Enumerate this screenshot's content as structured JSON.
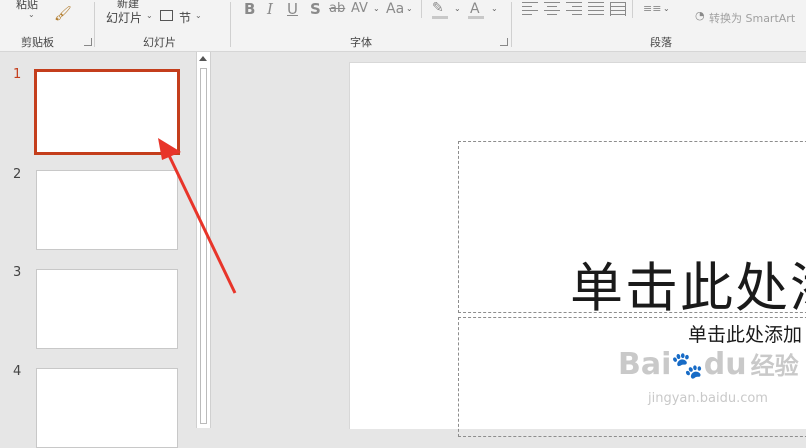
{
  "ribbon": {
    "paste_label": "粘贴",
    "new_slide_top": "新建",
    "new_slide_bottom": "幻灯片",
    "section_label": "节",
    "groups": {
      "clipboard": "剪贴板",
      "slides": "幻灯片",
      "font": "字体",
      "paragraph": "段落"
    },
    "font_buttons": {
      "bold": "B",
      "italic": "I",
      "underline": "U",
      "shadow": "S",
      "strike": "ab",
      "spacing": "AV",
      "case": "Aa"
    },
    "convert_smartart": "转换为 SmartArt"
  },
  "thumbnails": [
    {
      "number": "1",
      "selected": true
    },
    {
      "number": "2",
      "selected": false
    },
    {
      "number": "3",
      "selected": false
    },
    {
      "number": "4",
      "selected": false
    }
  ],
  "slide": {
    "title_placeholder": "单击此处添",
    "subtitle_placeholder": "单击此处添加"
  },
  "watermark": {
    "brand": "Bai",
    "brand2": "经验",
    "url": "jingyan.baidu.com"
  },
  "colors": {
    "accent": "#c43e1c",
    "arrow": "#e8352a"
  }
}
